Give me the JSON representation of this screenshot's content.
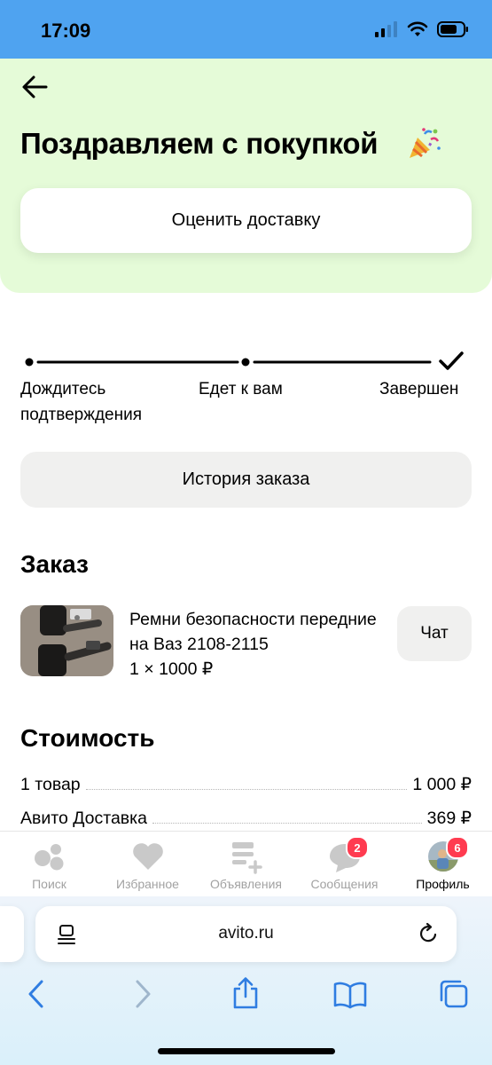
{
  "status_bar": {
    "time": "17:09"
  },
  "header": {
    "title": "Поздравляем с покупкой",
    "rate_button_label": "Оценить доставку"
  },
  "progress": {
    "steps": [
      {
        "label": "Дождитесь подтверждения"
      },
      {
        "label": "Едет к вам"
      },
      {
        "label": "Завершен"
      }
    ]
  },
  "history_button_label": "История заказа",
  "order": {
    "section_title": "Заказ",
    "product": {
      "name": "Ремни безопасности передние на Ваз 2108-2115",
      "quantity_price": "1 × 1000 ₽"
    },
    "chat_button_label": "Чат"
  },
  "cost": {
    "section_title": "Стоимость",
    "rows": [
      {
        "label": "1 товар",
        "value": "1 000 ₽"
      },
      {
        "label": "Авито Доставка",
        "value": "369 ₽"
      }
    ]
  },
  "tab_bar": {
    "tabs": [
      {
        "label": "Поиск",
        "icon": "search-dots-icon"
      },
      {
        "label": "Избранное",
        "icon": "heart-icon"
      },
      {
        "label": "Объявления",
        "icon": "listings-icon"
      },
      {
        "label": "Сообщения",
        "icon": "chat-bubble-icon",
        "badge": "2"
      },
      {
        "label": "Профиль",
        "icon": "avatar",
        "badge": "6"
      }
    ]
  },
  "browser": {
    "url": "avito.ru"
  },
  "colors": {
    "status_bar": "#4fa3f0",
    "hero_background": "#e5fbd8",
    "badge": "#ff3b50",
    "safari_accent": "#2f7de1",
    "inactive_tab": "#a2a2a2"
  }
}
